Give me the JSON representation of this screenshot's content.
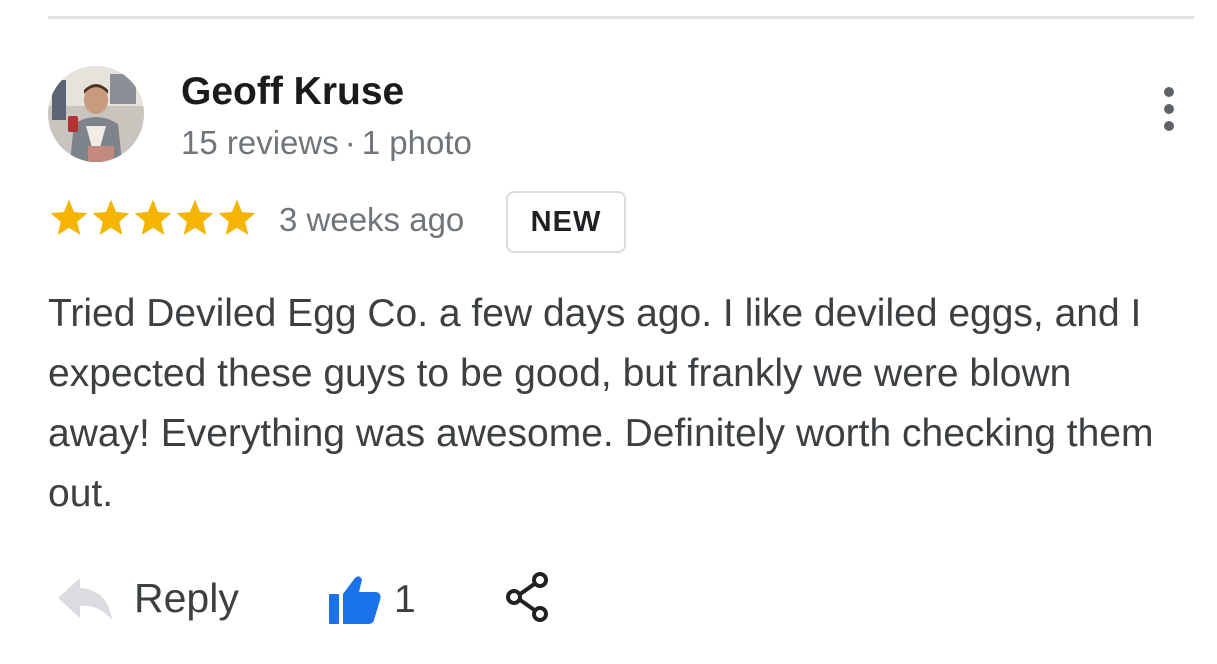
{
  "review": {
    "author": {
      "name": "Geoff Kruse",
      "reviews_count": "15 reviews",
      "separator": "·",
      "photos_count": "1 photo"
    },
    "rating": 5,
    "rating_max": 5,
    "star_color": "#f4b400",
    "time_ago": "3 weeks ago",
    "badge": "NEW",
    "text": "Tried Deviled Egg Co. a few days ago. I like deviled eggs, and I expected these guys to be good, but frankly we were blown away! Everything was awesome. Definitely worth checking them out."
  },
  "actions": {
    "reply_label": "Reply",
    "reply_icon": "reply-arrow-icon",
    "like_icon": "thumbs-up-icon",
    "like_color": "#1a73e8",
    "like_count": "1",
    "share_icon": "share-icon"
  },
  "menu": {
    "icon": "more-vert-icon"
  }
}
